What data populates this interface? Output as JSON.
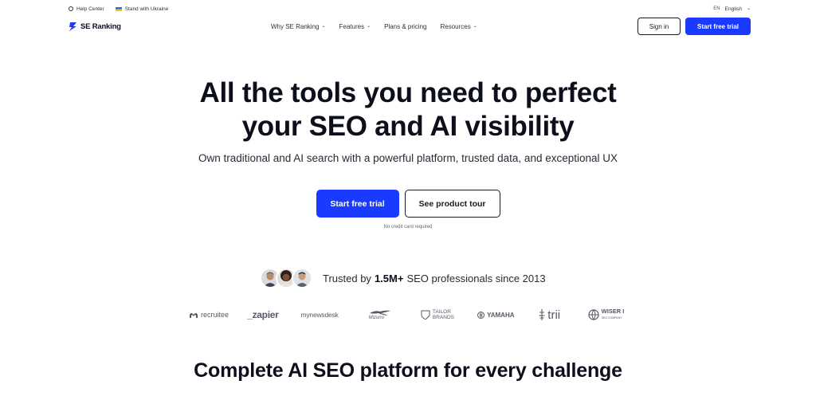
{
  "util_bar": {
    "help_center": "Help Center",
    "stand_with_ukraine": "Stand with Ukraine",
    "lang_code": "EN",
    "language": "English"
  },
  "brand": {
    "name": "SE Ranking",
    "accent": "#1a3bff"
  },
  "nav": {
    "items": [
      {
        "label": "Why SE Ranking",
        "has_dropdown": true
      },
      {
        "label": "Features",
        "has_dropdown": true
      },
      {
        "label": "Plans & pricing",
        "has_dropdown": false
      },
      {
        "label": "Resources",
        "has_dropdown": true
      }
    ],
    "sign_in": "Sign in",
    "start_trial": "Start free trial"
  },
  "hero": {
    "title_line1": "All the tools you need to perfect",
    "title_line2": "your SEO and AI visibility",
    "subtitle": "Own traditional and AI search with a powerful platform, trusted data, and exceptional UX",
    "cta_primary": "Start free trial",
    "cta_secondary": "See product tour",
    "note": "No credit card required"
  },
  "trust": {
    "prefix": "Trusted by",
    "highlight": "1.5M+",
    "suffix": "SEO professionals since 2013"
  },
  "logos": {
    "recruitee": "recruitee",
    "zapier": "_zapier",
    "newsdesk": "mynewsdesk",
    "mizuno": "Mizuno",
    "tailor_1": "TAILOR",
    "tailor_2": "BRANDS",
    "yamaha": "YAMAHA",
    "trii": "trii",
    "wiser_1": "WISER I",
    "wiser_2": "SEO COMPANY"
  },
  "section": {
    "title": "Complete AI SEO platform for every challenge"
  },
  "colors": {
    "accent": "#1a3bff",
    "text": "#0d0f1c",
    "logo_gray": "#555a66"
  }
}
